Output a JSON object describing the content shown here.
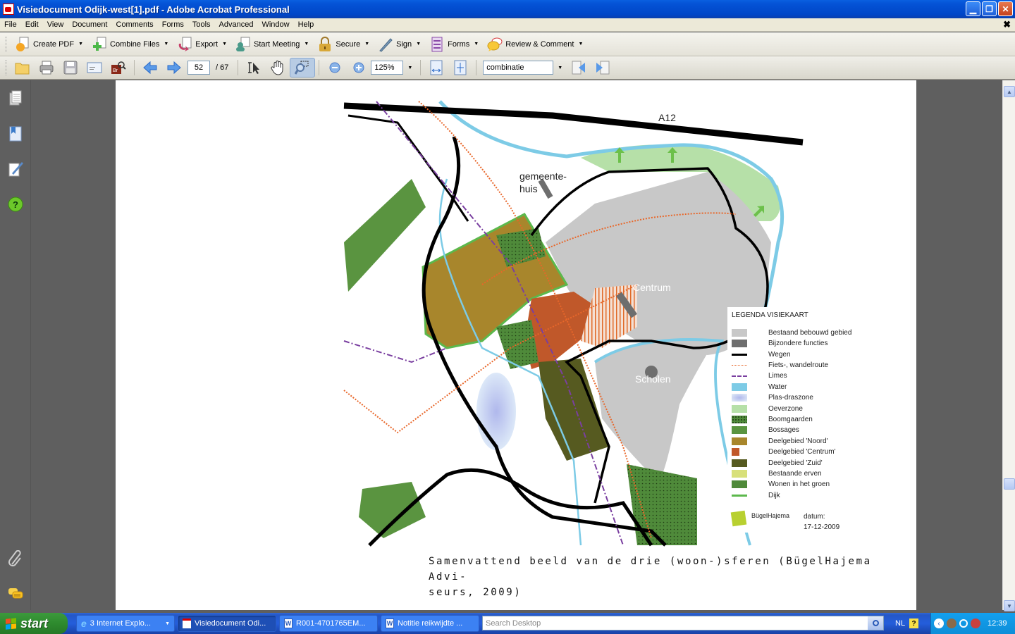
{
  "window": {
    "title": "Visiedocument Odijk-west[1].pdf - Adobe Acrobat Professional"
  },
  "menu": [
    "File",
    "Edit",
    "View",
    "Document",
    "Comments",
    "Forms",
    "Tools",
    "Advanced",
    "Window",
    "Help"
  ],
  "task_toolbar": [
    {
      "label": "Create PDF",
      "icon": "create-pdf-icon"
    },
    {
      "label": "Combine Files",
      "icon": "combine-files-icon"
    },
    {
      "label": "Export",
      "icon": "export-icon"
    },
    {
      "label": "Start Meeting",
      "icon": "start-meeting-icon"
    },
    {
      "label": "Secure",
      "icon": "lock-icon"
    },
    {
      "label": "Sign",
      "icon": "pen-icon"
    },
    {
      "label": "Forms",
      "icon": "forms-icon"
    },
    {
      "label": "Review & Comment",
      "icon": "comment-icon"
    }
  ],
  "nav_toolbar": {
    "current_page": "52",
    "total_pages": "/ 67",
    "zoom": "125%",
    "find_value": "combinatie"
  },
  "colors": {
    "built_area": "#c8c8c8",
    "special_functions": "#6e6e6e",
    "water": "#7dcbe6",
    "bank_zone": "#b6e0a8",
    "orchards": "#4f8a3a",
    "woods": "#5a9440",
    "north": "#a8862c",
    "centrum": "#c0582a",
    "south": "#565a20",
    "yards": "#d8e07a",
    "dyke": "#5cb84c",
    "route": "#e8672a",
    "limes": "#7a3fa0"
  },
  "map": {
    "labels": {
      "a12": "A12",
      "gemeentehuis_1": "gemeente-",
      "gemeentehuis_2": "huis",
      "centrum": "Centrum",
      "scholen": "Scholen"
    },
    "legend_title": "LEGENDA VISIEKAART",
    "legend": [
      {
        "label": "Bestaand bebouwd gebied",
        "swatch": "built_area"
      },
      {
        "label": "Bijzondere functies",
        "swatch": "special_functions"
      },
      {
        "label": "Wegen",
        "swatch": "road"
      },
      {
        "label": "Fiets-, wandelroute",
        "swatch": "route"
      },
      {
        "label": "Limes",
        "swatch": "limes"
      },
      {
        "label": "Water",
        "swatch": "water"
      },
      {
        "label": "Plas-draszone",
        "swatch": "wet_zone"
      },
      {
        "label": "Oeverzone",
        "swatch": "bank_zone"
      },
      {
        "label": "Boomgaarden",
        "swatch": "orchards"
      },
      {
        "label": "Bossages",
        "swatch": "woods"
      },
      {
        "label": "Deelgebied 'Noord'",
        "swatch": "north"
      },
      {
        "label": "Deelgebied 'Centrum'",
        "swatch": "centrum"
      },
      {
        "label": "Deelgebied 'Zuid'",
        "swatch": "south"
      },
      {
        "label": "Bestaande erven",
        "swatch": "yards"
      },
      {
        "label": "Wonen in het groen",
        "swatch": "green_living"
      },
      {
        "label": "Dijk",
        "swatch": "dyke"
      }
    ],
    "logo": "BügelHajema",
    "date_label": "datum:",
    "date": "17-12-2009"
  },
  "caption": "Samenvattend beeld van de drie (woon-)sferen (BügelHajema Advi- seurs, 2009)",
  "caption_line1": "Samenvattend beeld van de drie (woon-)sferen (BügelHajema Advi-",
  "caption_line2": "seurs, 2009)",
  "taskbar": {
    "start": "start",
    "tasks": [
      {
        "label": "3 Internet Explo...",
        "icon": "ie-icon"
      },
      {
        "label": "Visiedocument Odi...",
        "icon": "pdf-icon",
        "active": true
      },
      {
        "label": "R001-4701765EM...",
        "icon": "word-icon"
      },
      {
        "label": "Notitie reikwijdte ...",
        "icon": "word-icon"
      }
    ],
    "search_placeholder": "Search Desktop",
    "language": "NL",
    "clock": "12:39"
  }
}
